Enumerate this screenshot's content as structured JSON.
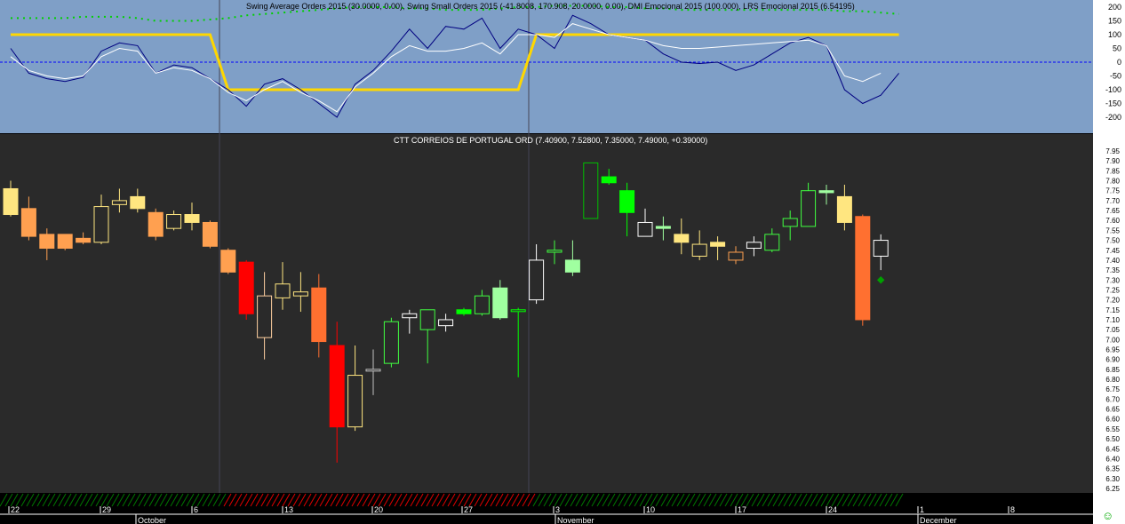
{
  "indicator_title": "Swing Average Orders 2015 (30.0000, 0.00), Swing Small Orders 2015 (-41.8008, 170.908, 20.0000, 0.00), DMI Emocional 2015 (100.000), LRS Emocional 2015 (6.54195)",
  "price_title": "CTT CORREIOS DE PORTUGAL ORD (7.40900, 7.52800, 7.35000, 7.49000, +0.39000)",
  "colors": {
    "top_bg": "#7f9fc7",
    "bottom_bg": "#2a2a2a",
    "yellow": "#ffd700",
    "navy": "#000080",
    "white": "#ffffff",
    "green_dots": "#00d000"
  },
  "chart_data": [
    {
      "type": "line",
      "title": "Swing Average Orders 2015 (30.0000, 0.00), Swing Small Orders 2015 (-41.8008, 170.908, 20.0000, 0.00), DMI Emocional 2015 (100.000), LRS Emocional 2015 (6.54195)",
      "ylim": [
        -250,
        220
      ],
      "yticks": [
        200,
        150,
        100,
        50,
        0,
        -50,
        -100,
        -150,
        -200
      ],
      "series": [
        {
          "name": "DMI Emocional",
          "color": "#ffd700",
          "values": [
            100,
            100,
            100,
            100,
            100,
            100,
            100,
            100,
            100,
            100,
            100,
            100,
            -100,
            -100,
            -100,
            -100,
            -100,
            -100,
            -100,
            -100,
            -100,
            -100,
            -100,
            -100,
            -100,
            -100,
            -100,
            -100,
            -100,
            100,
            100,
            100,
            100,
            100,
            100,
            100,
            100,
            100,
            100,
            100,
            100,
            100,
            100,
            100,
            100,
            100,
            100,
            100,
            100,
            100
          ]
        },
        {
          "name": "Swing Average Orders",
          "color": "#000080",
          "values": [
            50,
            -40,
            -60,
            -70,
            -55,
            40,
            70,
            60,
            -40,
            -10,
            -20,
            -60,
            -100,
            -160,
            -80,
            -60,
            -100,
            -150,
            -200,
            -80,
            -30,
            40,
            120,
            50,
            130,
            120,
            160,
            50,
            120,
            100,
            50,
            170,
            140,
            100,
            90,
            80,
            30,
            0,
            -5,
            0,
            -30,
            -10,
            30,
            70,
            90,
            60,
            -100,
            -150,
            -120,
            -40
          ]
        },
        {
          "name": "Swing Small Orders",
          "color": "#ffffff",
          "values": [
            20,
            -30,
            -50,
            -60,
            -50,
            20,
            50,
            40,
            -40,
            -20,
            -30,
            -60,
            -110,
            -140,
            -100,
            -70,
            -110,
            -140,
            -180,
            -90,
            -40,
            20,
            60,
            40,
            40,
            50,
            70,
            30,
            100,
            100,
            90,
            140,
            120,
            100,
            90,
            80,
            60,
            50,
            50,
            55,
            60,
            65,
            70,
            75,
            80,
            60,
            -50,
            -70,
            -40
          ]
        },
        {
          "name": "LRS Emocional",
          "color": "#00d000",
          "values": [
            160,
            160,
            160,
            160,
            165,
            165,
            165,
            160,
            150,
            150,
            150,
            155,
            160,
            170,
            175,
            180,
            185,
            190,
            195,
            200,
            200,
            200,
            195,
            195,
            190,
            190,
            190,
            195,
            200,
            200,
            205,
            205,
            205,
            200,
            200,
            195,
            195,
            190,
            190,
            190,
            190,
            190,
            190,
            190,
            190,
            190,
            185,
            185,
            180,
            175
          ]
        }
      ]
    },
    {
      "type": "candlestick",
      "title": "CTT CORREIOS DE PORTUGAL ORD (7.40900, 7.52800, 7.35000, 7.49000, +0.39000)",
      "ylim": [
        6.25,
        7.97
      ],
      "yticks": [
        "7.95",
        "7.90",
        "7.85",
        "7.80",
        "7.75",
        "7.70",
        "7.65",
        "7.60",
        "7.55",
        "7.50",
        "7.45",
        "7.40",
        "7.35",
        "7.30",
        "7.25",
        "7.20",
        "7.15",
        "7.10",
        "7.05",
        "7.00",
        "6.95",
        "6.90",
        "6.85",
        "6.80",
        "6.75",
        "6.70",
        "6.65",
        "6.60",
        "6.55",
        "6.50",
        "6.45",
        "6.40",
        "6.35",
        "6.30",
        "6.25"
      ],
      "ohlc": [
        [
          7.76,
          7.8,
          7.62,
          7.63,
          "#ffe680",
          1
        ],
        [
          7.66,
          7.72,
          7.5,
          7.52,
          "#ffa050",
          1
        ],
        [
          7.53,
          7.56,
          7.4,
          7.46,
          "#ffa050",
          1
        ],
        [
          7.46,
          7.53,
          7.45,
          7.53,
          "#ffa050",
          1
        ],
        [
          7.51,
          7.54,
          7.48,
          7.49,
          "#ffa050",
          1
        ],
        [
          7.49,
          7.73,
          7.48,
          7.67,
          "#ffe680",
          0
        ],
        [
          7.68,
          7.76,
          7.64,
          7.7,
          "#ffe680",
          0
        ],
        [
          7.72,
          7.76,
          7.64,
          7.66,
          "#ffe680",
          1
        ],
        [
          7.64,
          7.66,
          7.5,
          7.52,
          "#ffa050",
          1
        ],
        [
          7.56,
          7.65,
          7.55,
          7.63,
          "#ffe680",
          0
        ],
        [
          7.63,
          7.69,
          7.55,
          7.59,
          "#ffe680",
          1
        ],
        [
          7.59,
          7.6,
          7.46,
          7.47,
          "#ffa050",
          1
        ],
        [
          7.45,
          7.46,
          7.33,
          7.34,
          "#ffa050",
          1
        ],
        [
          7.39,
          7.4,
          7.1,
          7.13,
          "#ff0000",
          1
        ],
        [
          7.01,
          7.34,
          6.9,
          7.22,
          "#ffd0a0",
          0
        ],
        [
          7.21,
          7.39,
          7.15,
          7.28,
          "#ffe680",
          0
        ],
        [
          7.22,
          7.34,
          7.14,
          7.24,
          "#ffe680",
          0
        ],
        [
          7.26,
          7.33,
          6.91,
          6.99,
          "#ff7030",
          1
        ],
        [
          6.97,
          7.09,
          6.38,
          6.56,
          "#ff0000",
          1
        ],
        [
          6.56,
          6.97,
          6.54,
          6.82,
          "#ffe680",
          0
        ],
        [
          6.85,
          6.95,
          6.72,
          6.85,
          "#c0c0c0",
          0
        ],
        [
          6.88,
          7.11,
          6.86,
          7.09,
          "#40ff40",
          0
        ],
        [
          7.11,
          7.15,
          7.03,
          7.13,
          "#ffffff",
          0
        ],
        [
          7.05,
          7.15,
          6.88,
          7.15,
          "#40ff40",
          0
        ],
        [
          7.07,
          7.13,
          7.04,
          7.1,
          "#ffffff",
          0
        ],
        [
          7.15,
          7.16,
          7.12,
          7.13,
          "#00ff00",
          1
        ],
        [
          7.13,
          7.25,
          7.12,
          7.22,
          "#40ff40",
          0
        ],
        [
          7.26,
          7.3,
          7.1,
          7.11,
          "#a0ffa0",
          1
        ],
        [
          7.15,
          7.16,
          6.81,
          7.15,
          "#00ff00",
          0
        ],
        [
          7.2,
          7.48,
          7.18,
          7.4,
          "#ffffff",
          0
        ],
        [
          7.44,
          7.5,
          7.38,
          7.45,
          "#40ff40",
          0
        ],
        [
          7.4,
          7.5,
          7.32,
          7.34,
          "#a0ffa0",
          1
        ],
        [
          7.61,
          7.89,
          7.61,
          7.89,
          "#00c000",
          0
        ],
        [
          7.82,
          7.86,
          7.78,
          7.79,
          "#00ff00",
          1
        ],
        [
          7.75,
          7.79,
          7.52,
          7.64,
          "#00ff00",
          1
        ],
        [
          7.52,
          7.66,
          7.52,
          7.59,
          "#ffffff",
          0
        ],
        [
          7.57,
          7.62,
          7.5,
          7.56,
          "#a0ffa0",
          1
        ],
        [
          7.53,
          7.61,
          7.43,
          7.49,
          "#ffe680",
          1
        ],
        [
          7.42,
          7.55,
          7.4,
          7.48,
          "#ffe680",
          0
        ],
        [
          7.49,
          7.52,
          7.4,
          7.47,
          "#ffe680",
          1
        ],
        [
          7.44,
          7.47,
          7.38,
          7.4,
          "#ffa050",
          0
        ],
        [
          7.46,
          7.52,
          7.42,
          7.49,
          "#ffffff",
          0
        ],
        [
          7.45,
          7.56,
          7.44,
          7.53,
          "#40ff40",
          0
        ],
        [
          7.57,
          7.65,
          7.5,
          7.61,
          "#40ff40",
          0
        ],
        [
          7.57,
          7.79,
          7.57,
          7.75,
          "#40ff40",
          0
        ],
        [
          7.75,
          7.78,
          7.68,
          7.74,
          "#a0ffa0",
          1
        ],
        [
          7.72,
          7.78,
          7.55,
          7.59,
          "#ffe680",
          1
        ],
        [
          7.62,
          7.63,
          7.07,
          7.1,
          "#ff7030",
          1
        ],
        [
          7.42,
          7.53,
          7.35,
          7.5,
          "#ffffff",
          0
        ]
      ],
      "marker": {
        "value": 7.3,
        "color": "#00a000"
      }
    },
    {
      "type": "timeaxis",
      "days": [
        "22",
        "29",
        "6",
        "13",
        "20",
        "27",
        "3",
        "10",
        "17",
        "24",
        "1",
        "8"
      ],
      "months": [
        "October",
        "November",
        "December"
      ]
    }
  ]
}
